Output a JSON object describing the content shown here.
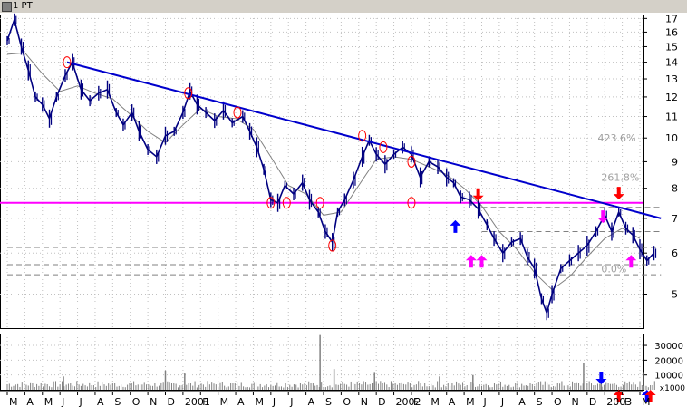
{
  "window": {
    "title": "1 PT"
  },
  "chart_data": {
    "type": "line",
    "price_axis": {
      "scale": "log",
      "ylim": [
        4.3,
        17.3
      ],
      "tick_labels": [
        "17",
        "16",
        "15",
        "14",
        "13",
        "12",
        "11",
        "10",
        "9",
        "8",
        "7",
        "6",
        "5"
      ],
      "tick_values": [
        17,
        16,
        15,
        14,
        13,
        12,
        11,
        10,
        9,
        8,
        7,
        6,
        5
      ]
    },
    "volume_axis": {
      "ylim": [
        0,
        38000
      ],
      "tick_labels": [
        "30000",
        "20000",
        "10000"
      ],
      "tick_values": [
        30000,
        20000,
        10000
      ],
      "unit_label": "x1000"
    },
    "x_axis": {
      "tick_labels": [
        "M",
        "A",
        "M",
        "J",
        "J",
        "A",
        "S",
        "O",
        "N",
        "D",
        "2001",
        "F",
        "M",
        "A",
        "M",
        "J",
        "J",
        "A",
        "S",
        "O",
        "N",
        "D",
        "2002",
        "F",
        "M",
        "A",
        "M",
        "J",
        "J",
        "A",
        "S",
        "O",
        "N",
        "D",
        "2003",
        "F",
        "M"
      ],
      "start_month": "2000-03",
      "end_month": "2003-03"
    },
    "price_series": [
      [
        0,
        15.4
      ],
      [
        0.4,
        16.9
      ],
      [
        0.8,
        15.0
      ],
      [
        1.2,
        13.5
      ],
      [
        1.6,
        12.0
      ],
      [
        2.0,
        11.6
      ],
      [
        2.4,
        10.9
      ],
      [
        2.8,
        12.0
      ],
      [
        3.3,
        13.2
      ],
      [
        3.7,
        14.0
      ],
      [
        4.2,
        12.4
      ],
      [
        4.7,
        11.8
      ],
      [
        5.2,
        12.2
      ],
      [
        5.7,
        12.4
      ],
      [
        6.2,
        11.2
      ],
      [
        6.6,
        10.6
      ],
      [
        7.1,
        11.2
      ],
      [
        7.5,
        10.3
      ],
      [
        8.0,
        9.5
      ],
      [
        8.5,
        9.2
      ],
      [
        9.0,
        10.1
      ],
      [
        9.5,
        10.3
      ],
      [
        10.0,
        11.2
      ],
      [
        10.4,
        12.3
      ],
      [
        10.8,
        11.6
      ],
      [
        11.3,
        11.2
      ],
      [
        11.8,
        10.8
      ],
      [
        12.3,
        11.3
      ],
      [
        12.8,
        10.7
      ],
      [
        13.4,
        11.0
      ],
      [
        13.8,
        10.3
      ],
      [
        14.2,
        9.6
      ],
      [
        14.6,
        8.7
      ],
      [
        15.0,
        7.6
      ],
      [
        15.4,
        7.5
      ],
      [
        15.8,
        8.1
      ],
      [
        16.3,
        7.8
      ],
      [
        16.8,
        8.2
      ],
      [
        17.2,
        7.6
      ],
      [
        17.7,
        7.2
      ],
      [
        18.1,
        6.6
      ],
      [
        18.5,
        6.3
      ],
      [
        18.8,
        7.2
      ],
      [
        19.2,
        7.6
      ],
      [
        19.7,
        8.3
      ],
      [
        20.2,
        9.2
      ],
      [
        20.6,
        9.9
      ],
      [
        21.0,
        9.3
      ],
      [
        21.5,
        8.9
      ],
      [
        22.0,
        9.3
      ],
      [
        22.5,
        9.6
      ],
      [
        23.0,
        9.3
      ],
      [
        23.5,
        8.4
      ],
      [
        24.0,
        9.0
      ],
      [
        24.5,
        8.8
      ],
      [
        25.0,
        8.4
      ],
      [
        25.4,
        8.2
      ],
      [
        25.8,
        7.7
      ],
      [
        26.3,
        7.6
      ],
      [
        26.8,
        7.3
      ],
      [
        27.3,
        6.8
      ],
      [
        27.7,
        6.4
      ],
      [
        28.2,
        6.0
      ],
      [
        28.7,
        6.3
      ],
      [
        29.2,
        6.4
      ],
      [
        29.6,
        5.9
      ],
      [
        30.0,
        5.6
      ],
      [
        30.4,
        4.9
      ],
      [
        30.7,
        4.6
      ],
      [
        31.0,
        5.0
      ],
      [
        31.5,
        5.6
      ],
      [
        32.0,
        5.8
      ],
      [
        32.5,
        6.0
      ],
      [
        33.0,
        6.2
      ],
      [
        33.5,
        6.6
      ],
      [
        34.0,
        7.1
      ],
      [
        34.4,
        6.6
      ],
      [
        34.8,
        7.2
      ],
      [
        35.2,
        6.7
      ],
      [
        35.6,
        6.5
      ],
      [
        36.0,
        6.1
      ],
      [
        36.4,
        5.8
      ],
      [
        36.8,
        6.0
      ]
    ],
    "ma_series": [
      [
        0,
        14.5
      ],
      [
        1,
        14.6
      ],
      [
        2,
        13.3
      ],
      [
        3,
        12.3
      ],
      [
        4,
        12.6
      ],
      [
        5,
        12.2
      ],
      [
        6,
        11.9
      ],
      [
        7,
        11.1
      ],
      [
        8,
        10.3
      ],
      [
        9,
        9.8
      ],
      [
        10,
        10.6
      ],
      [
        11,
        11.4
      ],
      [
        12,
        11.0
      ],
      [
        13,
        10.9
      ],
      [
        14,
        10.4
      ],
      [
        15,
        9.2
      ],
      [
        16,
        8.1
      ],
      [
        17,
        7.8
      ],
      [
        18,
        7.1
      ],
      [
        19,
        7.2
      ],
      [
        20,
        8.1
      ],
      [
        21,
        9.1
      ],
      [
        22,
        9.2
      ],
      [
        23,
        9.1
      ],
      [
        24,
        8.8
      ],
      [
        25,
        8.5
      ],
      [
        26,
        8.0
      ],
      [
        27,
        7.4
      ],
      [
        28,
        6.6
      ],
      [
        29,
        6.1
      ],
      [
        30,
        5.5
      ],
      [
        31,
        5.1
      ],
      [
        32,
        5.4
      ],
      [
        33,
        5.9
      ],
      [
        34,
        6.4
      ],
      [
        35,
        6.7
      ],
      [
        36,
        6.4
      ]
    ],
    "trendline": {
      "from": [
        3.4,
        14.0
      ],
      "to": [
        37.2,
        7.0
      ]
    },
    "support_line": {
      "value": 7.5
    },
    "dashed_levels": [
      {
        "value": 7.35,
        "from": 27.0,
        "to": 37.2
      },
      {
        "value": 6.6,
        "from": 27.0,
        "to": 37.2
      },
      {
        "value": 6.15,
        "from": 0,
        "to": 37.2
      },
      {
        "value": 5.7,
        "from": 0,
        "to": 37.2
      },
      {
        "value": 5.45,
        "from": 0,
        "to": 37.2
      }
    ],
    "fibonacci": [
      {
        "label": "423.6%",
        "value": 10.0,
        "x": 33.6
      },
      {
        "label": "261.8%",
        "value": 8.4,
        "x": 33.8
      },
      {
        "label": "0.0%",
        "value": 5.6,
        "x": 33.8
      }
    ],
    "circles": [
      [
        3.4,
        14.0
      ],
      [
        10.3,
        12.2
      ],
      [
        13.1,
        11.2
      ],
      [
        15.0,
        7.5
      ],
      [
        15.9,
        7.5
      ],
      [
        17.8,
        7.5
      ],
      [
        18.5,
        6.2
      ],
      [
        20.2,
        10.1
      ],
      [
        21.4,
        9.6
      ],
      [
        23.0,
        9.0
      ],
      [
        23.0,
        7.5
      ]
    ],
    "arrows": [
      {
        "x": 26.8,
        "value": 7.5,
        "dir": "down",
        "color": "#ff0000"
      },
      {
        "x": 34.8,
        "value": 7.55,
        "dir": "down",
        "color": "#ff0000"
      },
      {
        "x": 25.5,
        "value": 7.0,
        "dir": "up",
        "color": "#0000ff"
      },
      {
        "x": 26.4,
        "value": 6.0,
        "dir": "up",
        "color": "#ff00ff"
      },
      {
        "x": 27.0,
        "value": 6.0,
        "dir": "up",
        "color": "#ff00ff"
      },
      {
        "x": 33.9,
        "value": 6.8,
        "dir": "down",
        "color": "#ff00ff"
      },
      {
        "x": 35.5,
        "value": 6.0,
        "dir": "up",
        "color": "#ff00ff"
      }
    ],
    "volume_arrows": [
      {
        "x": 33.8,
        "dir": "down",
        "color": "#0000ff"
      },
      {
        "x": 34.8,
        "dir": "up",
        "color": "#ff0000"
      },
      {
        "x": 36.4,
        "dir": "up",
        "color": "#0000ff"
      },
      {
        "x": 36.6,
        "dir": "up",
        "color": "#ff0000"
      }
    ],
    "volume_spikes": [
      [
        3.2,
        9000
      ],
      [
        9.0,
        13000
      ],
      [
        10.1,
        11000
      ],
      [
        17.8,
        37000
      ],
      [
        18.6,
        14000
      ],
      [
        20.9,
        12000
      ],
      [
        24.6,
        9000
      ],
      [
        26.5,
        10000
      ],
      [
        32.8,
        18000
      ],
      [
        33.8,
        11000
      ],
      [
        36.2,
        12000
      ]
    ],
    "colors": {
      "price": "#000080",
      "ma": "#808080",
      "trendline": "#0000cc",
      "support": "#ff00ff",
      "circle": "#ff0000",
      "fib_text": "#a0a0a0",
      "grid": "#c0c0c0",
      "volume": "#808080"
    },
    "grid": true
  }
}
